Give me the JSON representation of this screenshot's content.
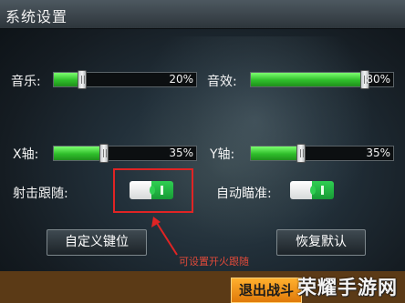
{
  "window": {
    "title": "系统设置"
  },
  "sliders": {
    "music": {
      "label": "音乐:",
      "value": "20%",
      "level": 20
    },
    "sfx": {
      "label": "音效:",
      "value": "80%",
      "level": 80
    },
    "x_axis": {
      "label": "X轴:",
      "value": "35%",
      "level": 35
    },
    "y_axis": {
      "label": "Y轴:",
      "value": "35%",
      "level": 35
    }
  },
  "toggles": {
    "fire_follow": {
      "label": "射击跟随:",
      "state": "on"
    },
    "auto_aim": {
      "label": "自动瞄准:",
      "state": "on"
    }
  },
  "buttons": {
    "custom_keys": "自定义键位",
    "restore_default": "恢复默认",
    "exit_battle": "退出战斗"
  },
  "annotation": {
    "note": "可设置开火跟随",
    "highlight_color": "#e02424"
  },
  "watermark": "荣耀手游网",
  "colors": {
    "slider_fill": "#2fbd2a",
    "toggle_on": "#2fcf52",
    "exit_button": "#f39a1a"
  }
}
